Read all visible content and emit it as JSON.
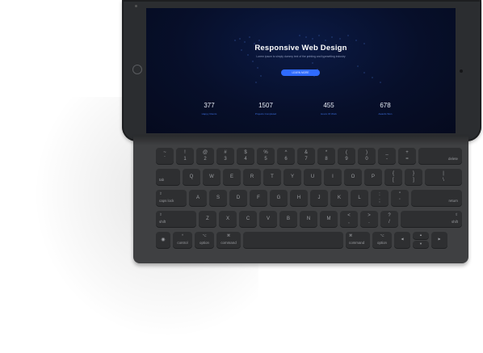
{
  "screen": {
    "title": "Responsive Web Design",
    "subtitle": "Lorem ipsum is simply dummy text of the printing and typesetting industry",
    "button_label": "LEARN MORE",
    "stats": [
      {
        "value": "377",
        "label": "Happy Clients"
      },
      {
        "value": "1507",
        "label": "Projects Completed"
      },
      {
        "value": "455",
        "label": "Hours Of Work"
      },
      {
        "value": "678",
        "label": "Awards Won"
      }
    ]
  },
  "keyboard": {
    "row1": [
      {
        "top": "~",
        "bottom": "`"
      },
      {
        "top": "!",
        "bottom": "1"
      },
      {
        "top": "@",
        "bottom": "2"
      },
      {
        "top": "#",
        "bottom": "3"
      },
      {
        "top": "$",
        "bottom": "4"
      },
      {
        "top": "%",
        "bottom": "5"
      },
      {
        "top": "^",
        "bottom": "6"
      },
      {
        "top": "&",
        "bottom": "7"
      },
      {
        "top": "*",
        "bottom": "8"
      },
      {
        "top": "(",
        "bottom": "9"
      },
      {
        "top": ")",
        "bottom": "0"
      },
      {
        "top": "_",
        "bottom": "-"
      },
      {
        "top": "+",
        "bottom": "="
      }
    ],
    "delete_label": "delete",
    "tab_label": "tab",
    "row2": [
      "Q",
      "W",
      "E",
      "R",
      "T",
      "Y",
      "U",
      "I",
      "O",
      "P"
    ],
    "row2_extra": [
      {
        "top": "{",
        "bottom": "["
      },
      {
        "top": "}",
        "bottom": "]"
      },
      {
        "top": "|",
        "bottom": "\\"
      }
    ],
    "capslock_label": "caps lock",
    "row3": [
      "A",
      "S",
      "D",
      "F",
      "G",
      "H",
      "J",
      "K",
      "L"
    ],
    "row3_extra": [
      {
        "top": ":",
        "bottom": ";"
      },
      {
        "top": "\"",
        "bottom": "'"
      }
    ],
    "return_label": "return",
    "shift_label": "shift",
    "row4": [
      "Z",
      "X",
      "C",
      "V",
      "B",
      "N",
      "M"
    ],
    "row4_extra": [
      {
        "top": "<",
        "bottom": ","
      },
      {
        "top": ">",
        "bottom": "."
      },
      {
        "top": "?",
        "bottom": "/"
      }
    ],
    "control_label": "control",
    "option_label": "option",
    "command_label": "command",
    "control_symbol": "^",
    "option_symbol": "⌥",
    "command_symbol": "⌘",
    "globe_symbol": "◉",
    "arrow_up": "▲",
    "arrow_down": "▼",
    "arrow_left": "◀",
    "arrow_right": "▶"
  },
  "colors": {
    "accent": "#2f6bff",
    "screen_bg": "#070f2a",
    "keyboard_bg": "#3f4042",
    "key_bg": "#2e2f31"
  }
}
